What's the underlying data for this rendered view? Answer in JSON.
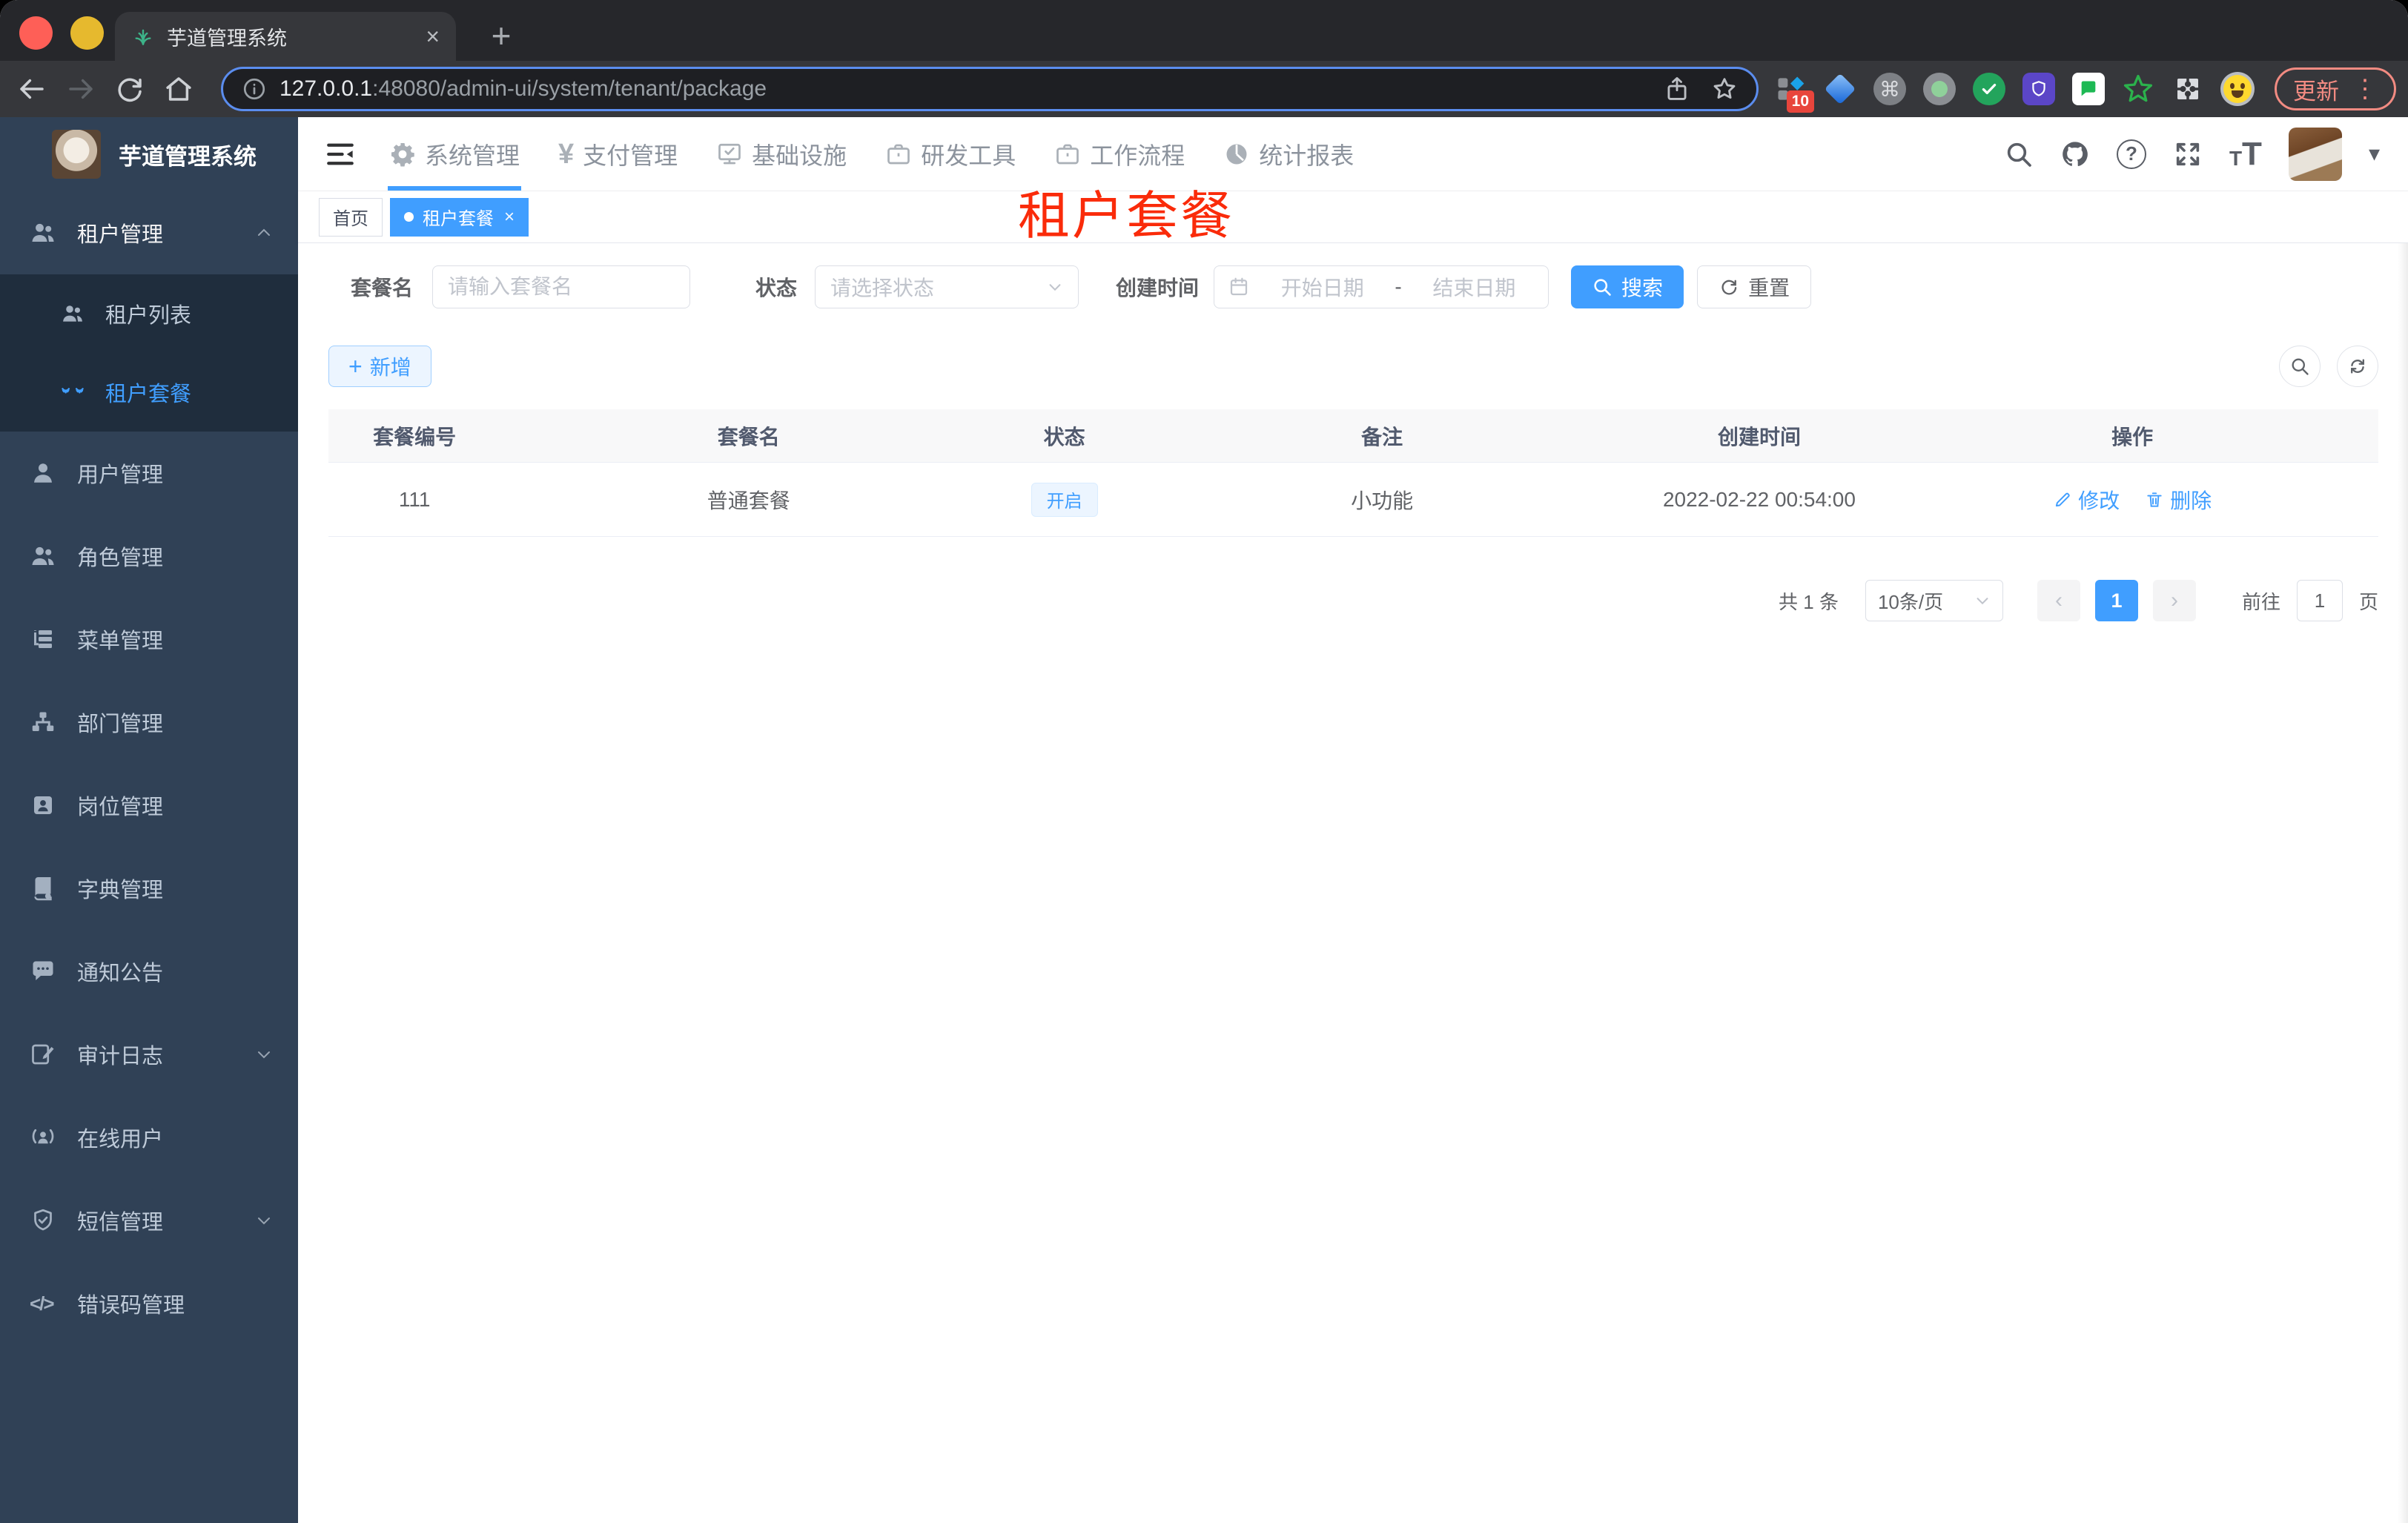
{
  "colors": {
    "accent": "#409eff",
    "sidebar-bg": "#304156",
    "submenu-bg": "#1f2d3d",
    "sidebar-text": "#bfcbd9",
    "annotation": "#fa2b0a",
    "chrome-frame": "#26272b",
    "chrome-surface": "#36373b",
    "urlbar-bg": "#1e1f23",
    "url-ring": "#5b8def",
    "update-chip": "#f28b82",
    "status-tag-bg": "#ecf5ff",
    "status-tag-border": "#d9ecff"
  },
  "browser": {
    "tab_title": "芋道管理系统",
    "url_host": "127.0.0.1",
    "url_path": ":48080/admin-ui/system/tenant/package",
    "update_label": "更新",
    "extension_badge_count": "10"
  },
  "sidebar": {
    "title": "芋道管理系统",
    "menu": [
      {
        "label": "租户管理",
        "children": [
          {
            "label": "租户列表"
          },
          {
            "label": "租户套餐"
          }
        ]
      },
      {
        "label": "用户管理"
      },
      {
        "label": "角色管理"
      },
      {
        "label": "菜单管理"
      },
      {
        "label": "部门管理"
      },
      {
        "label": "岗位管理"
      },
      {
        "label": "字典管理"
      },
      {
        "label": "通知公告"
      },
      {
        "label": "审计日志"
      },
      {
        "label": "在线用户"
      },
      {
        "label": "短信管理"
      },
      {
        "label": "错误码管理"
      }
    ]
  },
  "topnav": {
    "items": [
      {
        "label": "系统管理"
      },
      {
        "label": "支付管理"
      },
      {
        "label": "基础设施"
      },
      {
        "label": "研发工具"
      },
      {
        "label": "工作流程"
      },
      {
        "label": "统计报表"
      }
    ]
  },
  "tags": {
    "home": "首页",
    "current": "租户套餐"
  },
  "annotation": {
    "text": "租户套餐"
  },
  "filters": {
    "name_label": "套餐名",
    "name_placeholder": "请输入套餐名",
    "status_label": "状态",
    "status_placeholder": "请选择状态",
    "time_label": "创建时间",
    "start_placeholder": "开始日期",
    "range_separator": "-",
    "end_placeholder": "结束日期",
    "search_label": "搜索",
    "reset_label": "重置"
  },
  "toolbar": {
    "add_label": "新增"
  },
  "table": {
    "headers": [
      "套餐编号",
      "套餐名",
      "状态",
      "备注",
      "创建时间",
      "操作"
    ],
    "rows": [
      {
        "id": "111",
        "name": "普通套餐",
        "status": "开启",
        "remark": "小功能",
        "created": "2022-02-22 00:54:00",
        "edit_label": "修改",
        "delete_label": "删除"
      }
    ]
  },
  "pagination": {
    "total": "共 1 条",
    "page_size": "10条/页",
    "current_page": "1",
    "goto_label": "前往",
    "goto_value": "1",
    "page_unit": "页"
  },
  "icons": {
    "close": "×",
    "plus": "+",
    "prev": "‹",
    "next": "›",
    "caret": "▾",
    "question": "?",
    "yen": "¥",
    "code": "</>",
    "dots": "⋮",
    "text_size": "T",
    "command": "⌘"
  }
}
